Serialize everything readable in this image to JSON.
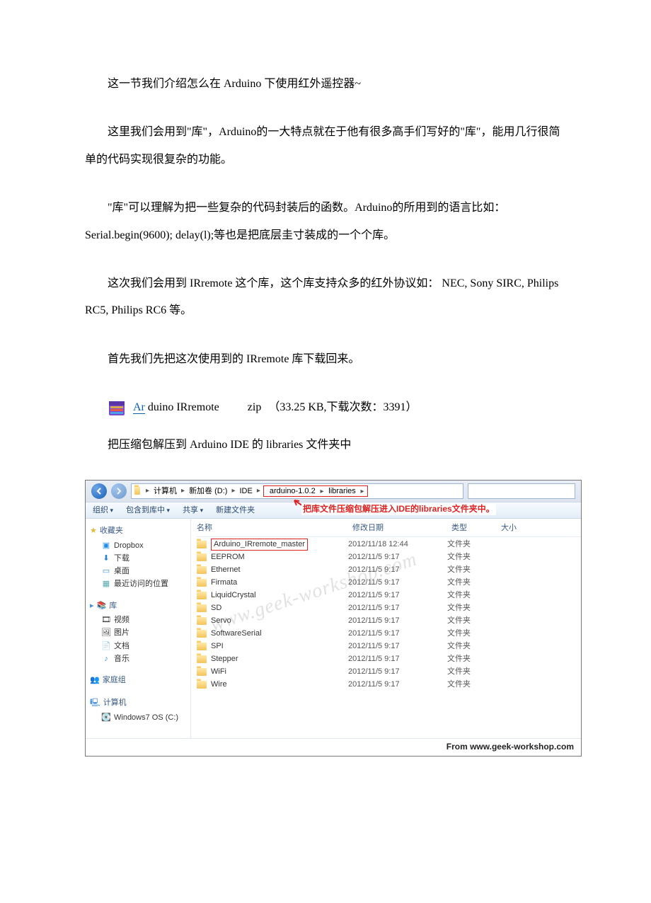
{
  "paragraphs": {
    "p1": "这一节我们介绍怎么在 Arduino 下使用红外遥控器~",
    "p2": "这里我们会用到\"库\"，Arduino的一大特点就在于他有很多高手们写好的\"库\"，能用几行很简单的代码实现很复杂的功能。",
    "p3": "\"库\"可以理解为把一些复杂的代码封装后的函数。Arduino的所用到的语言比如：Serial.begin(9600); delay(l);等也是把底层圭寸装成的一个个库。",
    "p4": "这次我们会用到 IRremote 这个库，这个库支持众多的红外协议如： NEC, Sony SIRC, Philips RC5, Philips RC6 等。",
    "p5": "首先我们先把这次使用到的 IRremote 库下载回来。",
    "p6": "把压缩包解压到 Arduino IDE 的 libraries 文件夹中"
  },
  "download": {
    "link_prefix": "Ar",
    "link_rest": "duino IRremote",
    "ext": "zip",
    "size": "（33.25 KB,下载次数：3391）"
  },
  "explorer": {
    "breadcrumb": [
      "计算机",
      "新加卷 (D:)",
      "IDE",
      "arduino-1.0.2",
      "libraries"
    ],
    "toolbar": {
      "organize": "组织",
      "include": "包含到库中",
      "share": "共享",
      "newfolder": "新建文件夹"
    },
    "callout": "把库文件压缩包解压进入IDE的libraries文件夹中。",
    "columns": {
      "name": "名称",
      "date": "修改日期",
      "type": "类型",
      "size": "大小"
    },
    "sidebar": {
      "favorites": "收藏夹",
      "dropbox": "Dropbox",
      "downloads": "下载",
      "desktop": "桌面",
      "recent": "最近访问的位置",
      "libraries": "库",
      "videos": "视频",
      "pictures": "图片",
      "documents": "文档",
      "music": "音乐",
      "homegroup": "家庭组",
      "computer": "计算机",
      "osdrive": "Windows7 OS (C:)"
    },
    "rows": [
      {
        "name": "Arduino_IRremote_master",
        "date": "2012/11/18 12:44",
        "type": "文件夹",
        "highlight": true
      },
      {
        "name": "EEPROM",
        "date": "2012/11/5 9:17",
        "type": "文件夹"
      },
      {
        "name": "Ethernet",
        "date": "2012/11/5 9:17",
        "type": "文件夹"
      },
      {
        "name": "Firmata",
        "date": "2012/11/5 9:17",
        "type": "文件夹"
      },
      {
        "name": "LiquidCrystal",
        "date": "2012/11/5 9:17",
        "type": "文件夹"
      },
      {
        "name": "SD",
        "date": "2012/11/5 9:17",
        "type": "文件夹"
      },
      {
        "name": "Servo",
        "date": "2012/11/5 9:17",
        "type": "文件夹"
      },
      {
        "name": "SoftwareSerial",
        "date": "2012/11/5 9:17",
        "type": "文件夹"
      },
      {
        "name": "SPI",
        "date": "2012/11/5 9:17",
        "type": "文件夹"
      },
      {
        "name": "Stepper",
        "date": "2012/11/5 9:17",
        "type": "文件夹"
      },
      {
        "name": "WiFi",
        "date": "2012/11/5 9:17",
        "type": "文件夹"
      },
      {
        "name": "Wire",
        "date": "2012/11/5 9:17",
        "type": "文件夹"
      }
    ],
    "watermark": "www.geek-workshop.com",
    "footer": "From www.geek-workshop.com"
  }
}
